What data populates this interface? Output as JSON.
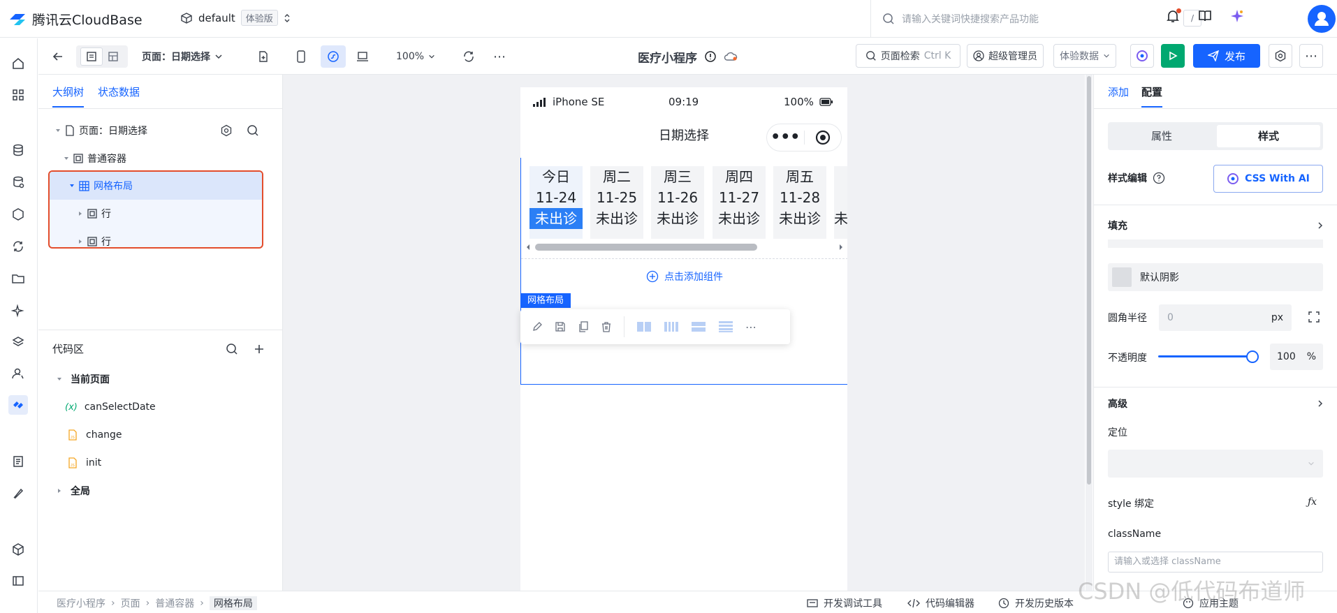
{
  "app": {
    "brand": "腾讯云CloudBase",
    "env_name": "default",
    "env_tag": "体验版",
    "search_placeholder": "请输入关键词快捷搜索产品功能",
    "search_shortcut": "/"
  },
  "toolbar": {
    "page_label": "页面：日期选择",
    "zoom": "100%",
    "title": "医疗小程序",
    "page_search": "页面检索",
    "page_search_shortcut": "Ctrl K",
    "role": "超级管理员",
    "data_mode": "体验数据",
    "publish": "发布"
  },
  "left": {
    "tabs": [
      "大纲树",
      "状态数据"
    ],
    "tree": {
      "page": "页面：日期选择",
      "container": "普通容器",
      "grid": "网格布局",
      "row1": "行",
      "row2": "行"
    },
    "code": {
      "title": "代码区",
      "current": "当前页面",
      "items": [
        "canSelectDate",
        "change",
        "init"
      ],
      "var_prefix": "(x)",
      "global": "全局"
    }
  },
  "phone": {
    "device": "iPhone SE",
    "time": "09:19",
    "battery": "100%",
    "title": "日期选择",
    "days": [
      {
        "name": "今日",
        "date": "11-24",
        "status": "未出诊"
      },
      {
        "name": "周二",
        "date": "11-25",
        "status": "未出诊"
      },
      {
        "name": "周三",
        "date": "11-26",
        "status": "未出诊"
      },
      {
        "name": "周四",
        "date": "11-27",
        "status": "未出诊"
      },
      {
        "name": "周五",
        "date": "11-28",
        "status": "未出诊"
      }
    ],
    "partial_status": "未",
    "add_component": "点击添加组件",
    "selected_label": "网格布局"
  },
  "right": {
    "tabs": [
      "添加",
      "配置"
    ],
    "seg": [
      "属性",
      "样式"
    ],
    "style_edit": "样式编辑",
    "css_ai": "CSS With AI",
    "fill": "填充",
    "shadow": "默认阴影",
    "radius_label": "圆角半径",
    "radius_placeholder": "0",
    "radius_unit": "px",
    "opacity_label": "不透明度",
    "opacity_value": "100",
    "opacity_unit": "%",
    "opacity_level": 100,
    "advanced": "高级",
    "position": "定位",
    "style_bind": "style 绑定",
    "classname": "className",
    "classname_placeholder": "请输入或选择 className"
  },
  "bottom": {
    "breadcrumb": [
      "医疗小程序",
      "页面",
      "普通容器",
      "网格布局"
    ],
    "tools": [
      "开发调试工具",
      "代码编辑器",
      "开发历史版本",
      "应用主题"
    ]
  },
  "watermark": "CSDN @低代码布道师",
  "colors": {
    "primary": "#1664ff",
    "run": "#00a870",
    "highlight": "#e34d2c"
  }
}
